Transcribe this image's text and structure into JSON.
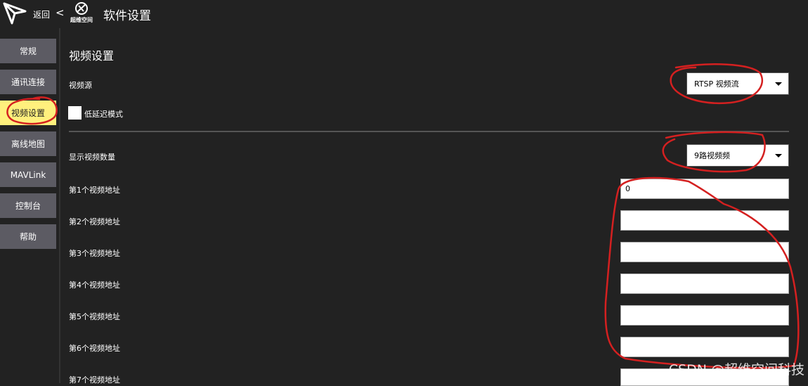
{
  "header": {
    "back_label": "返回",
    "back_chevron": "<",
    "title": "软件设置",
    "app_logo_icon": "paper-plane-logo",
    "brand_logo_icon": "superdimension-logo",
    "brand_logo_text": "超维空间"
  },
  "sidebar": {
    "items": [
      {
        "label": "常规",
        "active": false
      },
      {
        "label": "通讯连接",
        "active": false
      },
      {
        "label": "视频设置",
        "active": true
      },
      {
        "label": "离线地图",
        "active": false
      },
      {
        "label": "MAVLink",
        "active": false
      },
      {
        "label": "控制台",
        "active": false
      },
      {
        "label": "帮助",
        "active": false
      }
    ]
  },
  "main": {
    "section_title": "视频设置",
    "video_source": {
      "label": "视频源",
      "value": "RTSP 视频流"
    },
    "low_latency": {
      "label": "低延迟模式",
      "checked": false
    },
    "video_count": {
      "label": "显示视频数量",
      "value": "9路视频频"
    },
    "video_urls": [
      {
        "label": "第1个视频地址",
        "value": "0"
      },
      {
        "label": "第2个视频地址",
        "value": ""
      },
      {
        "label": "第3个视频地址",
        "value": ""
      },
      {
        "label": "第4个视频地址",
        "value": ""
      },
      {
        "label": "第5个视频地址",
        "value": ""
      },
      {
        "label": "第6个视频地址",
        "value": ""
      },
      {
        "label": "第7个视频地址",
        "value": ""
      }
    ]
  },
  "watermark": "CSDN @超维空间科技",
  "colors": {
    "background": "#222222",
    "nav_button": "#5c5b63",
    "nav_active": "#fff07d",
    "annotation_red": "#d42020"
  }
}
